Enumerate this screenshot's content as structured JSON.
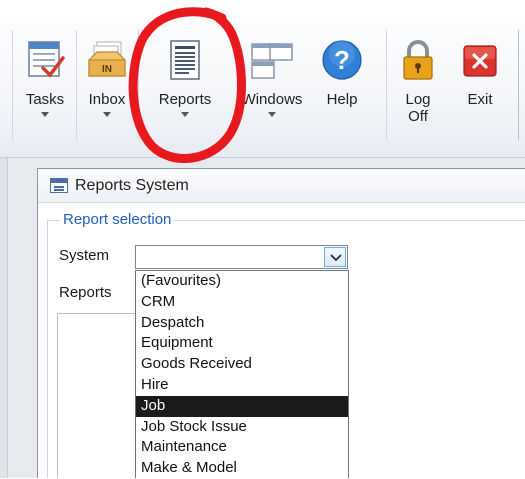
{
  "ribbon": {
    "buttons": [
      {
        "key": "tasks",
        "label": "Tasks",
        "icon": "tasks-icon",
        "dropdown": true
      },
      {
        "key": "inbox",
        "label": "Inbox",
        "icon": "inbox-icon",
        "dropdown": true
      },
      {
        "key": "reports",
        "label": "Reports",
        "icon": "reports-icon",
        "dropdown": true
      },
      {
        "key": "windows",
        "label": "Windows",
        "icon": "windows-icon",
        "dropdown": true
      },
      {
        "key": "help",
        "label": "Help",
        "icon": "help-icon",
        "dropdown": false
      },
      {
        "key": "logoff",
        "label": "Log\nOff",
        "icon": "lock-icon",
        "dropdown": false
      },
      {
        "key": "exit",
        "label": "Exit",
        "icon": "exit-icon",
        "dropdown": false
      }
    ],
    "inbox_icon_text": "IN",
    "help_icon_text": "?"
  },
  "window": {
    "title": "Reports System",
    "title_icon": "form-icon",
    "group_label": "Report selection",
    "system_label": "System",
    "system_value": "",
    "reports_label": "Reports"
  },
  "dropdown": {
    "items": [
      "(Favourites)",
      "CRM",
      "Despatch",
      "Equipment",
      "Goods Received",
      "Hire",
      "Job",
      "Job Stock Issue",
      "Maintenance",
      "Make & Model"
    ],
    "selected_index": 6
  },
  "colors": {
    "annotation": "#e8191e",
    "group_label": "#1f5fbf",
    "selected_bg": "#1a1a1a",
    "help_blue": "#2f7fd6",
    "exit_red": "#d9342b",
    "lock_gold": "#e8a31a"
  }
}
